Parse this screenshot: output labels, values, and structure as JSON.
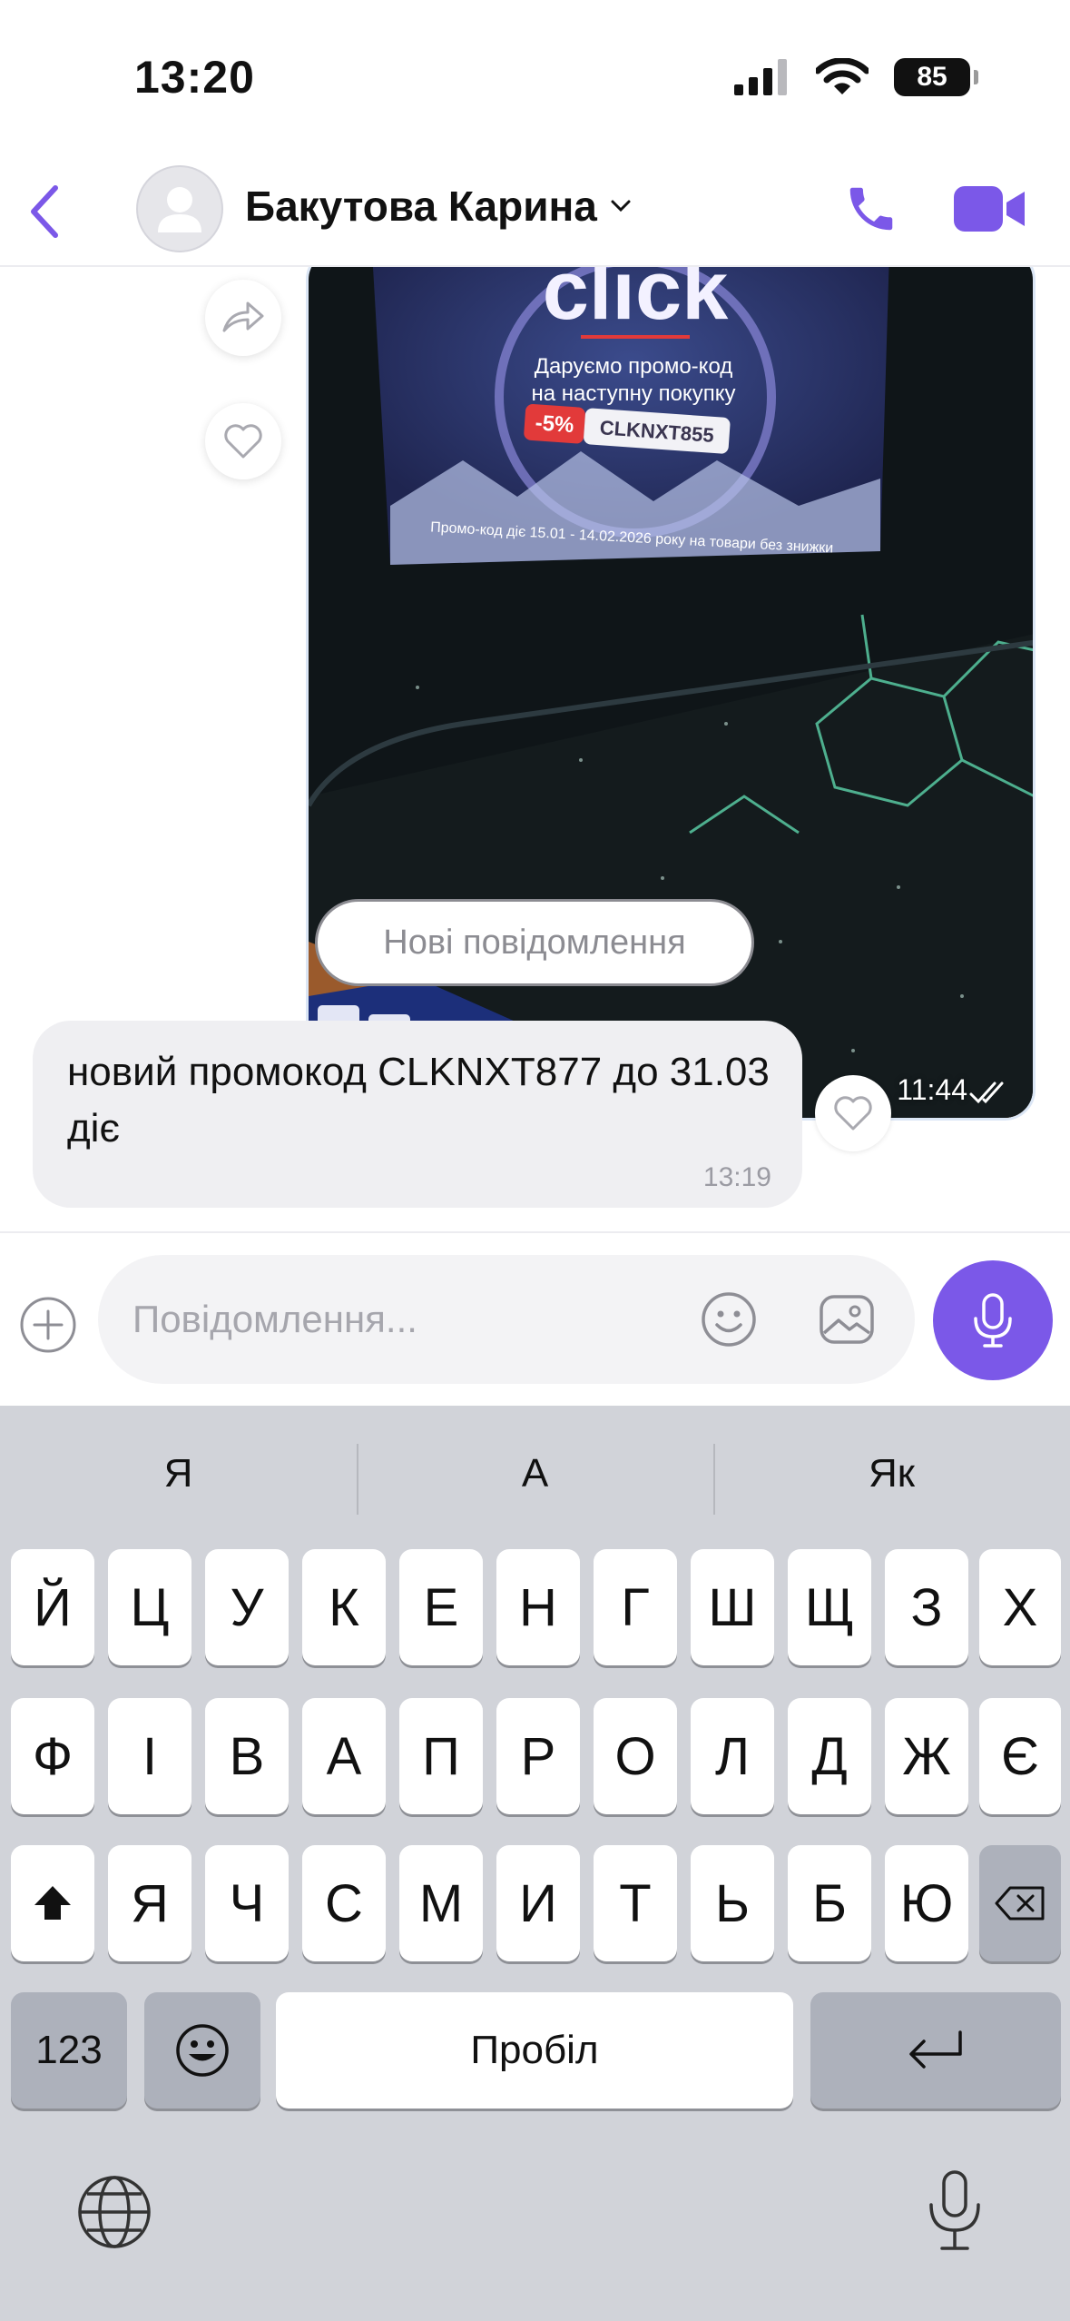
{
  "status_bar": {
    "time": "13:20",
    "battery": "85"
  },
  "header": {
    "contact_name": "Бакутова Карина"
  },
  "messages": {
    "photo": {
      "time": "11:44",
      "flyer": {
        "brand": "click",
        "line1": "Даруємо промо-код",
        "line2": "на наступну покупку",
        "discount": "-5%",
        "code": "CLKNXT855",
        "validity": "Промо-код діє 15.01 - 14.02.2026 року на товари без знижки"
      }
    },
    "new_messages_label": "Нові повідомлення",
    "incoming": {
      "text": "новий промокод CLKNXT877 до 31.03 діє",
      "time": "13:19"
    }
  },
  "composer": {
    "placeholder": "Повідомлення..."
  },
  "keyboard": {
    "suggestions": [
      "Я",
      "А",
      "Як"
    ],
    "row1": [
      "Й",
      "Ц",
      "У",
      "К",
      "Е",
      "Н",
      "Г",
      "Ш",
      "Щ",
      "З",
      "Х"
    ],
    "row2": [
      "Ф",
      "І",
      "В",
      "А",
      "П",
      "Р",
      "О",
      "Л",
      "Д",
      "Ж",
      "Є"
    ],
    "row3": [
      "Я",
      "Ч",
      "С",
      "М",
      "И",
      "Т",
      "Ь",
      "Б",
      "Ю"
    ],
    "numbers_label": "123",
    "space_label": "Пробіл"
  },
  "colors": {
    "accent": "#7b58e8",
    "keyboard_bg": "#d1d3d9",
    "bubble_in": "#efeff2"
  },
  "icons": [
    "back-chevron-icon",
    "person-icon",
    "chevron-down-icon",
    "phone-icon",
    "video-camera-icon",
    "share-icon",
    "heart-icon",
    "double-check-icon",
    "plus-icon",
    "smiley-icon",
    "gallery-icon",
    "microphone-icon",
    "shift-icon",
    "backspace-icon",
    "emoji-icon",
    "return-icon",
    "globe-icon"
  ]
}
